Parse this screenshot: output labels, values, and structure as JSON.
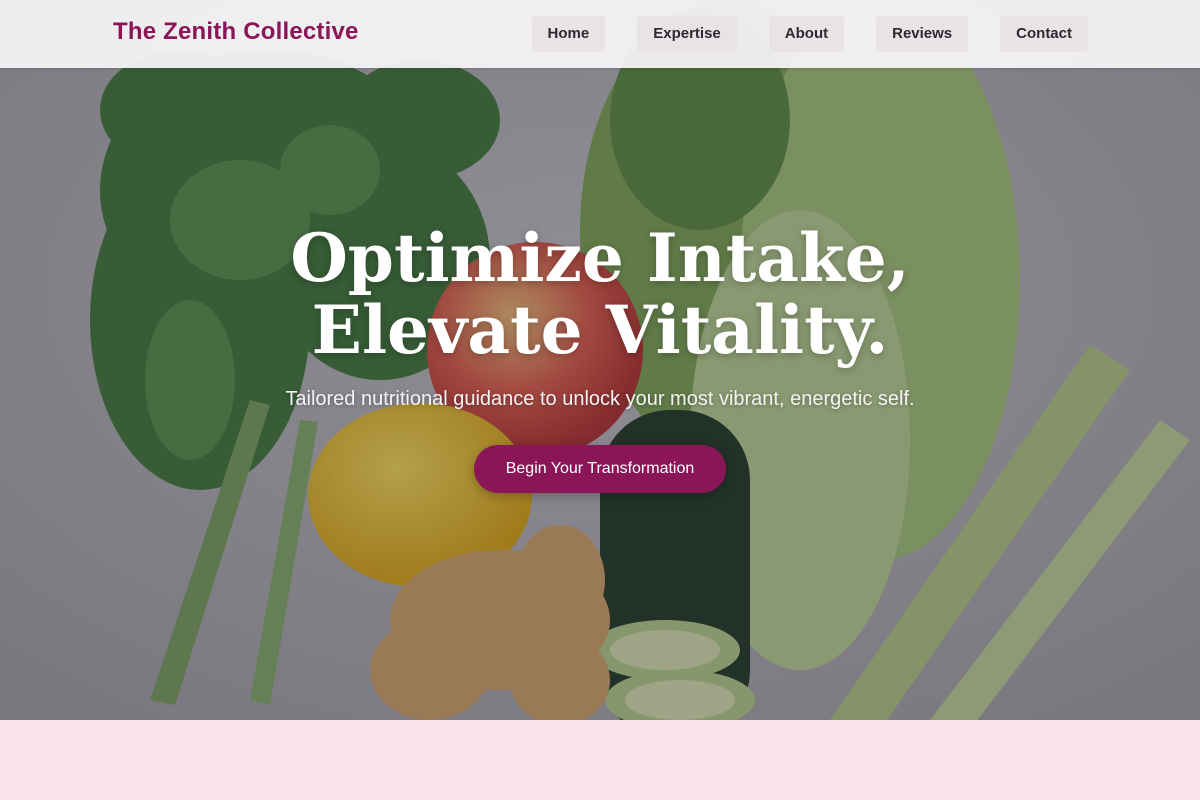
{
  "header": {
    "brand": "The Zenith Collective",
    "nav": [
      "Home",
      "Expertise",
      "About",
      "Reviews",
      "Contact"
    ]
  },
  "hero": {
    "title_line1": "Optimize Intake,",
    "title_line2": "Elevate Vitality.",
    "subtitle": "Tailored nutritional guidance to unlock your most vibrant, energetic self.",
    "cta_label": "Begin Your Transformation",
    "background_image": "fresh produce: kale, apple, lemon, ginger, cucumber, romaine, celery"
  },
  "colors": {
    "brand": "#8a1658",
    "section_bg": "#fbe3ea"
  }
}
